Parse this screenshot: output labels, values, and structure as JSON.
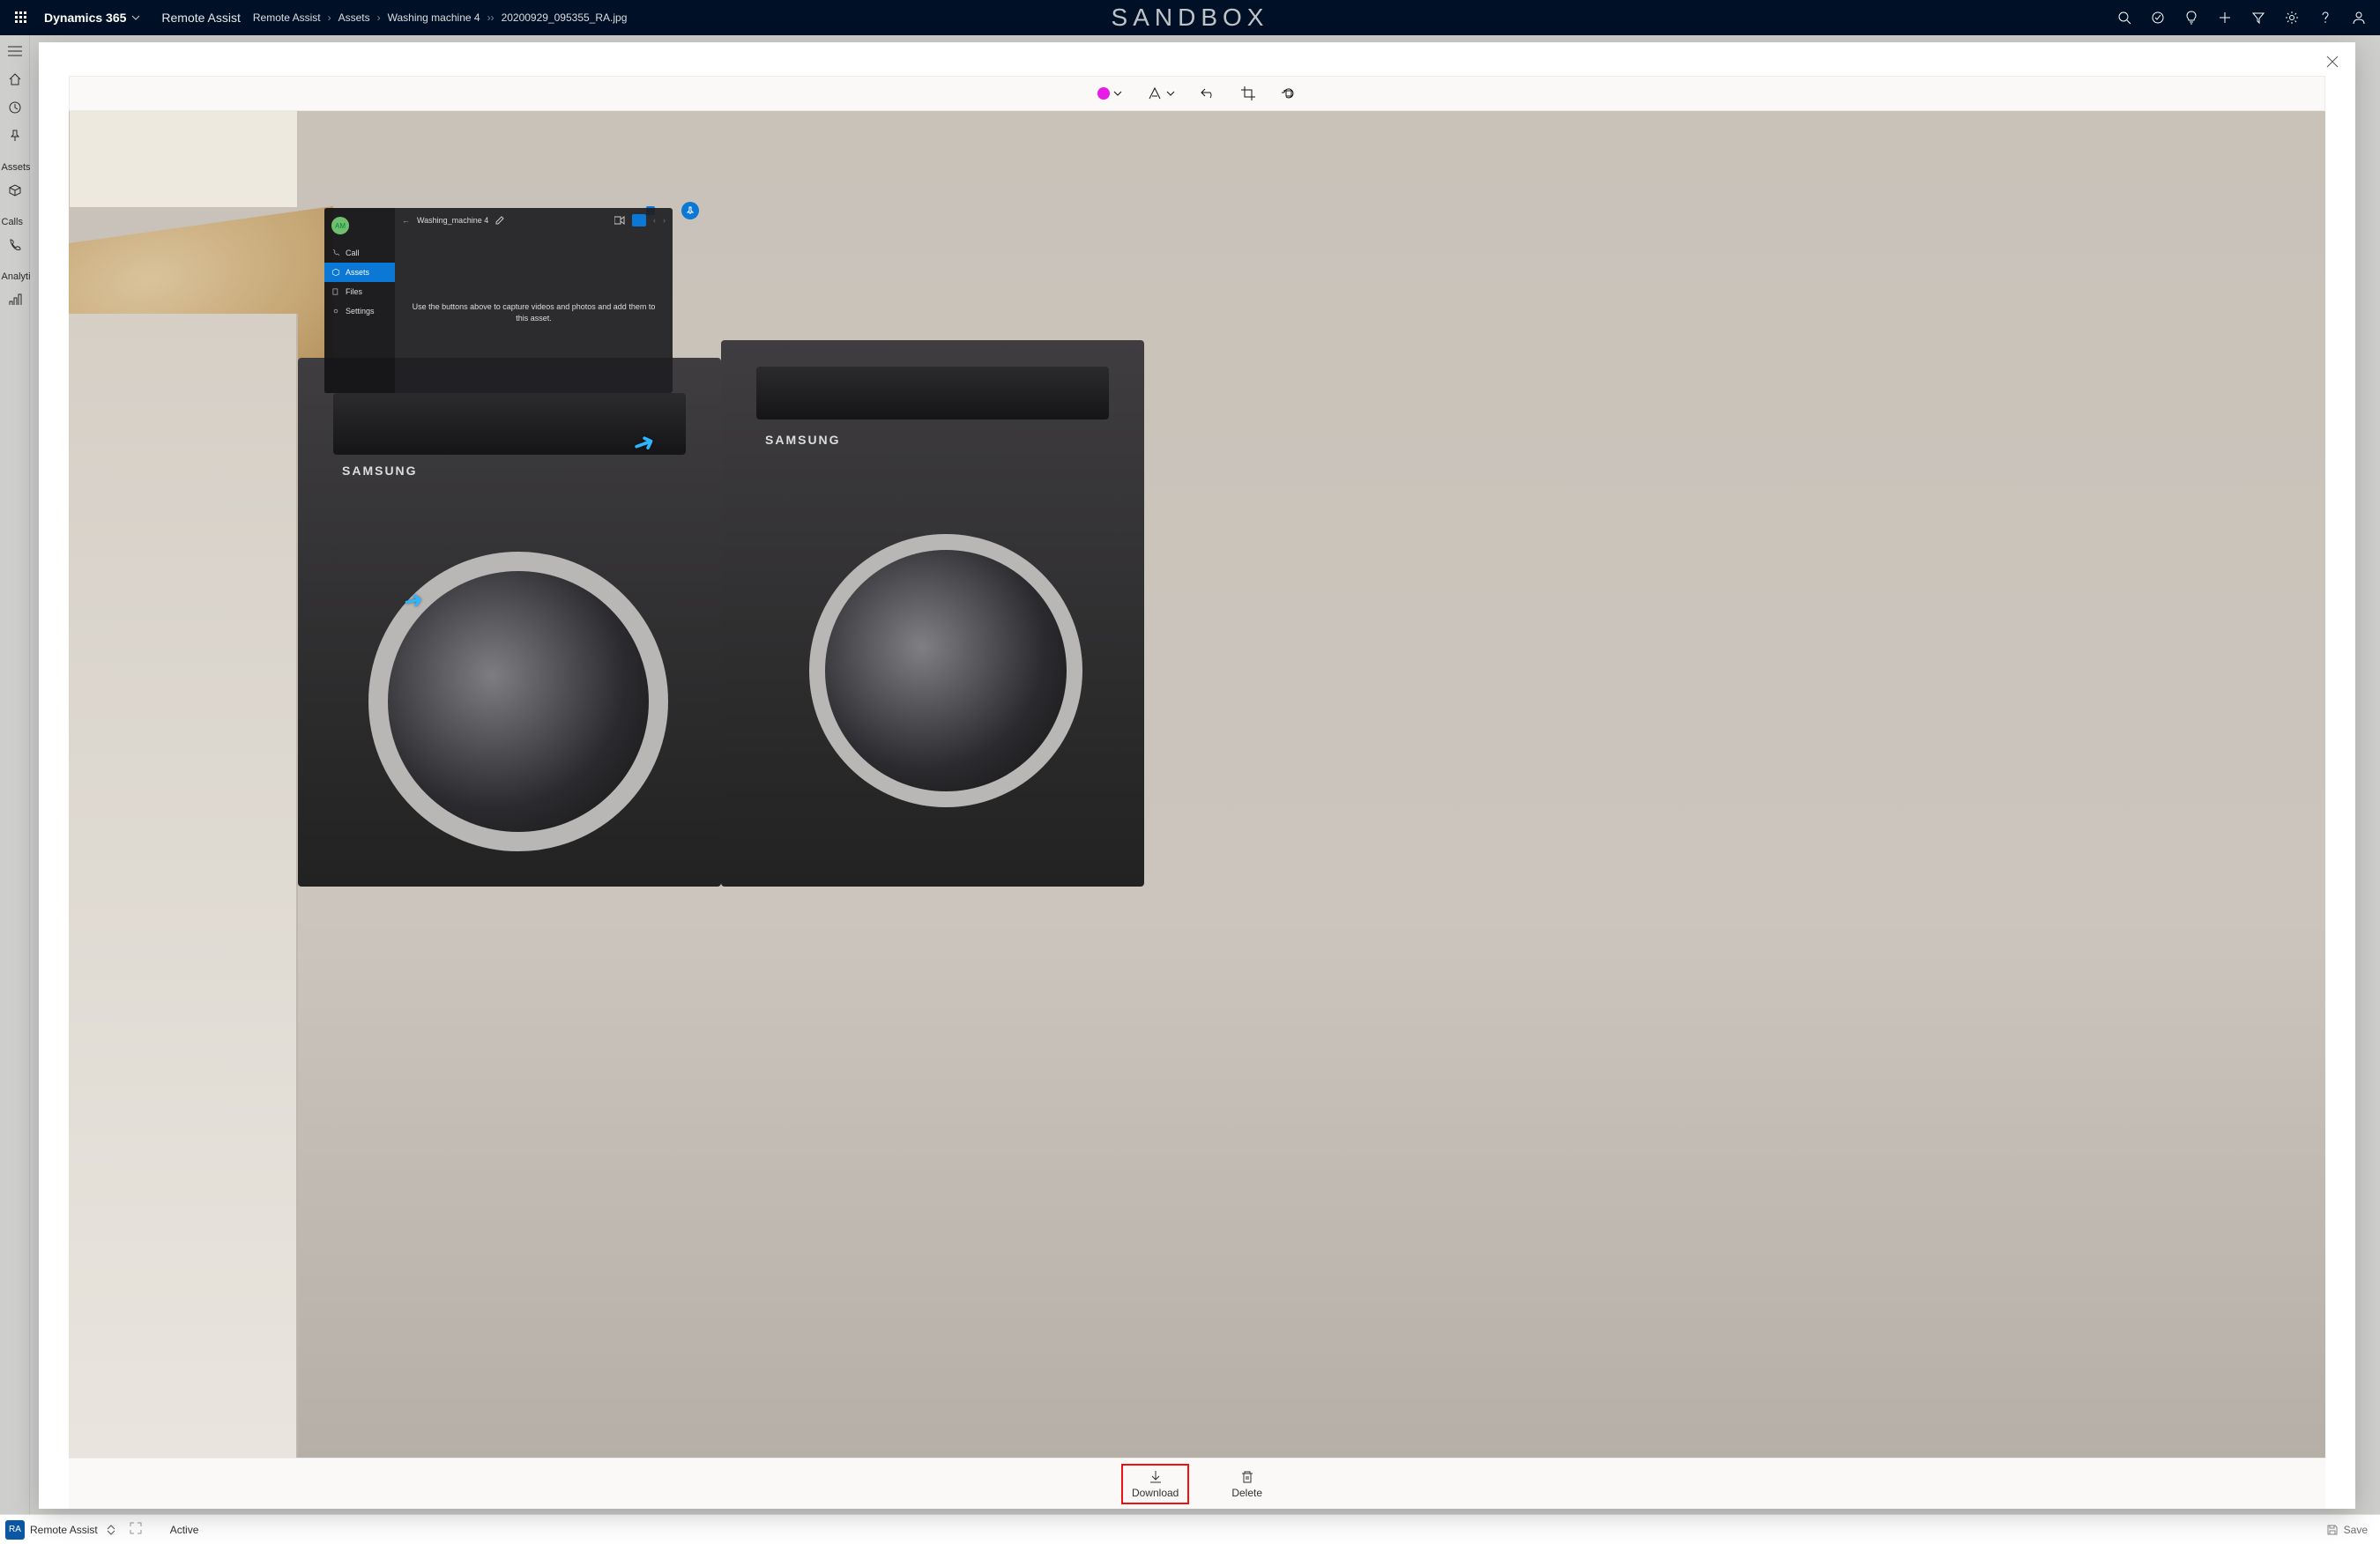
{
  "topbar": {
    "brand": "Dynamics 365",
    "app": "Remote Assist",
    "env": "SANDBOX",
    "breadcrumbs": [
      "Remote Assist",
      "Assets",
      "Washing machine 4",
      "20200929_095355_RA.jpg"
    ]
  },
  "leftnav": {
    "sections": [
      {
        "label": "Assets"
      },
      {
        "label": "Calls"
      },
      {
        "label": "Analytics"
      }
    ]
  },
  "bottombar": {
    "owner_initials": "RA",
    "owner_label": "Remote Assist",
    "status": "Active",
    "save": "Save"
  },
  "viewer": {
    "toolbar": {
      "color": "#E81CE8"
    },
    "footer": {
      "download": "Download",
      "delete": "Delete"
    }
  },
  "holo": {
    "avatar": "AM",
    "nav": {
      "call": "Call",
      "assets": "Assets",
      "files": "Files",
      "settings": "Settings"
    },
    "title": "Washing_machine 4",
    "body": "Use the buttons above to capture videos and photos and add them to this asset."
  },
  "scene": {
    "brand1": "SAMSUNG",
    "brand2": "SAMSUNG"
  }
}
